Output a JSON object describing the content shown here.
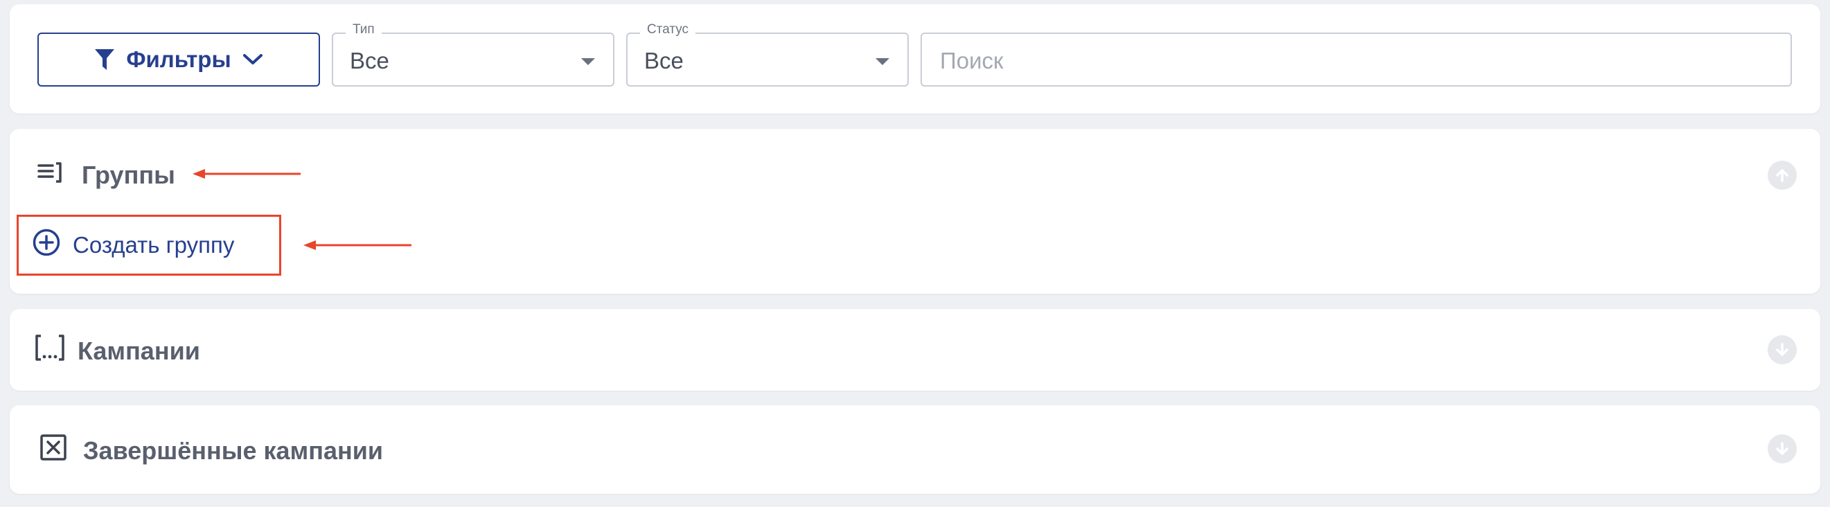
{
  "filters": {
    "button_label": "Фильтры",
    "type": {
      "legend": "Тип",
      "value": "Все"
    },
    "status": {
      "legend": "Статус",
      "value": "Все"
    },
    "search": {
      "placeholder": "Поиск"
    }
  },
  "sections": {
    "groups": {
      "title": "Группы",
      "create_label": "Создать группу"
    },
    "campaigns": {
      "title": "Кампании"
    },
    "completed": {
      "title": "Завершённые кампании"
    }
  },
  "colors": {
    "accent": "#263f8f",
    "annotation": "#e8452c",
    "section_title": "#5a5f6e",
    "background": "#eff0f3"
  },
  "icons": {
    "filter": "funnel-icon",
    "dropdown": "chevron-down-icon",
    "groups": "list-icon",
    "campaigns": "bracket-ellipsis-icon",
    "completed": "x-box-icon",
    "create": "plus-circle-icon",
    "collapse_up": "arrow-up-circle-icon",
    "expand_down": "arrow-down-circle-icon"
  }
}
